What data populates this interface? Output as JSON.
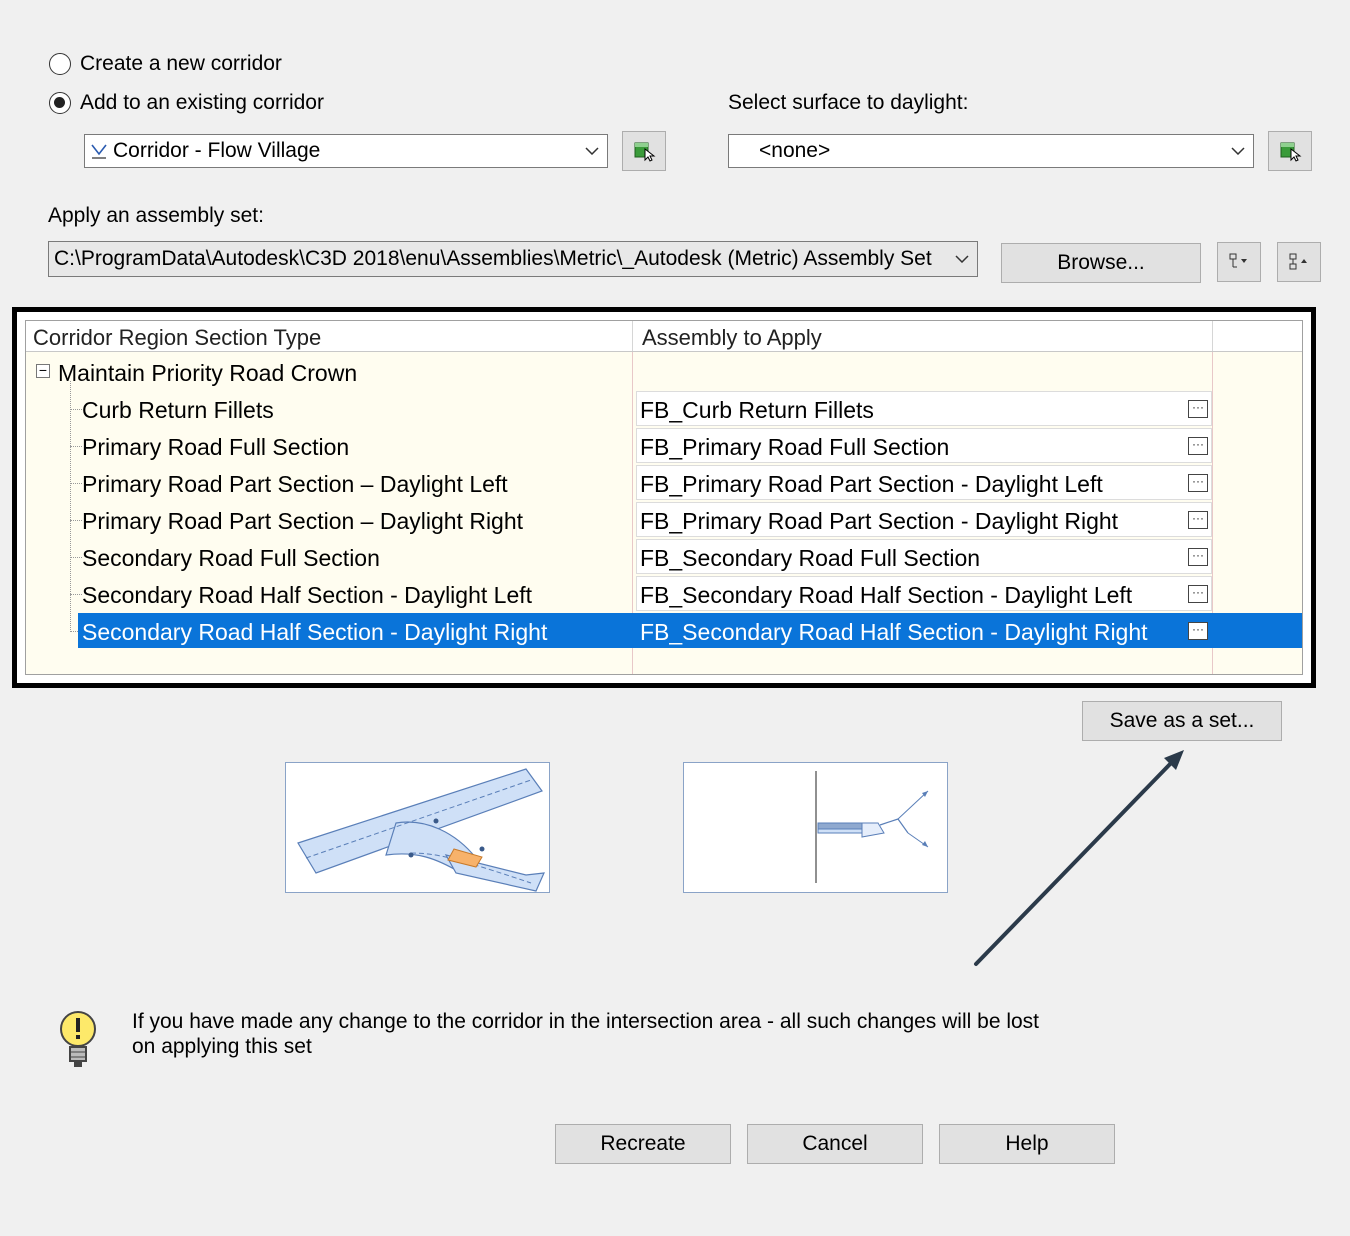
{
  "mode": {
    "create_label": "Create a new corridor",
    "add_label": "Add to an existing corridor"
  },
  "corridor": {
    "selected": "Corridor - Flow Village"
  },
  "surface": {
    "label": "Select surface to daylight:",
    "selected": "<none>"
  },
  "assembly_set": {
    "label": "Apply an assembly set:",
    "path": "C:\\ProgramData\\Autodesk\\C3D 2018\\enu\\Assemblies\\Metric\\_Autodesk (Metric) Assembly Set",
    "browse_label": "Browse..."
  },
  "grid": {
    "col1": "Corridor Region Section Type",
    "col2": "Assembly to Apply",
    "group": "Maintain Priority Road Crown",
    "rows": [
      {
        "type": "Curb Return Fillets",
        "assembly": "FB_Curb Return Fillets"
      },
      {
        "type": "Primary Road Full Section",
        "assembly": "FB_Primary Road Full Section"
      },
      {
        "type": "Primary Road Part Section – Daylight Left",
        "assembly": "FB_Primary Road Part Section - Daylight Left"
      },
      {
        "type": "Primary Road Part Section – Daylight Right",
        "assembly": "FB_Primary Road Part Section - Daylight Right"
      },
      {
        "type": "Secondary Road Full Section",
        "assembly": "FB_Secondary Road Full Section"
      },
      {
        "type": "Secondary Road Half Section - Daylight Left",
        "assembly": "FB_Secondary Road Half Section - Daylight Left"
      },
      {
        "type": "Secondary Road Half Section - Daylight Right",
        "assembly": "FB_Secondary Road Half Section - Daylight Right"
      }
    ],
    "selected_index": 6
  },
  "save_set_label": "Save as a set...",
  "warning": {
    "line1": "If you have made any change to the corridor in the intersection area - all such changes will be lost",
    "line2": "on applying this set"
  },
  "buttons": {
    "recreate": "Recreate",
    "cancel": "Cancel",
    "help": "Help"
  },
  "colors": {
    "selection": "#0a74d9",
    "grid_bg": "#fffdf0",
    "road_fill": "#cfe0f7",
    "highlight": "#f7b26b",
    "annotation_arrow": "#2b3a4a"
  }
}
